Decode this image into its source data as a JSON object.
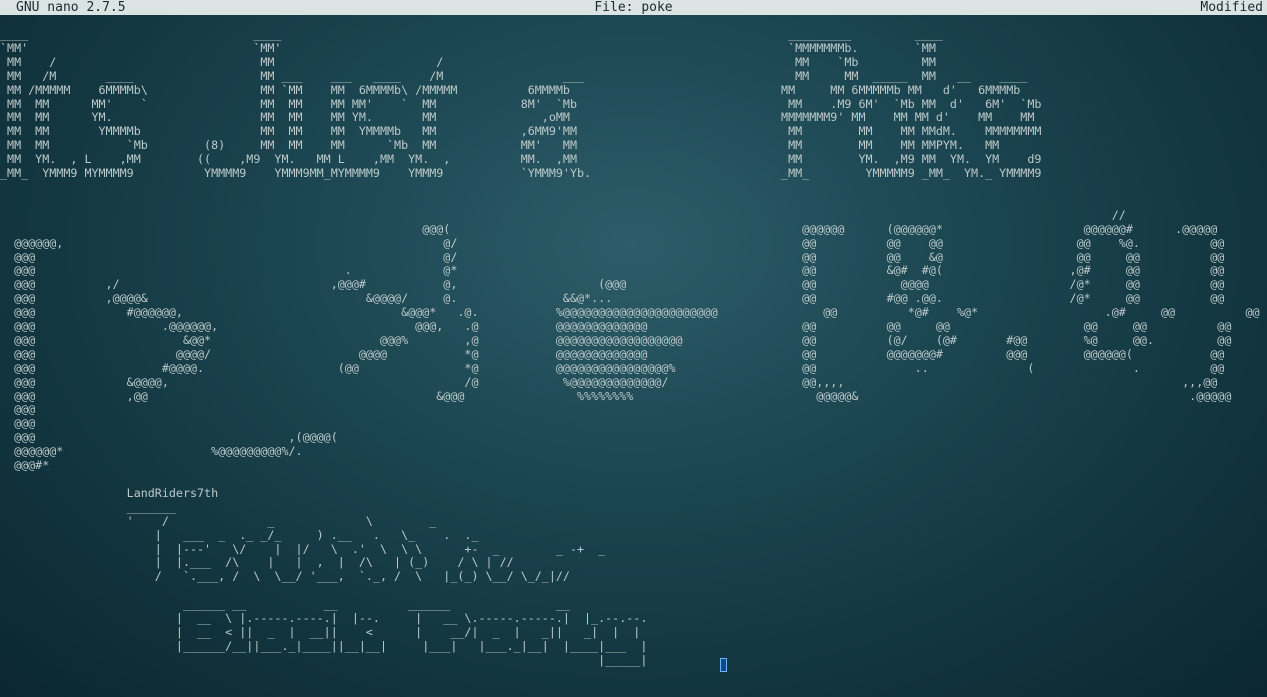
{
  "titlebar": {
    "version": "GNU nano 2.7.5",
    "file": "File: poke",
    "status": "Modified"
  },
  "buffer": {
    "lines": [
      "____                                ____                                                                        _________         ____",
      "`MM'                                `MM'                                                                        `MMMMMMMb.        `MM",
      " MM    /                             MM                       /                                                  MM    `Mb         MM",
      " MM   /M       ____                  MM ___    ___   ____    /M                 ___                              MM     MM  _____  MM   __    ____",
      " MM /MMMMM    6MMMMb\\                MM `MM    MM  6MMMMb\\ /MMMMM          6MMMMb                              MM     MM 6MMMMMb MM   d'   6MMMMb",
      " MM  MM      MM'    `                MM  MM    MM MM'    `  MM            8M'  `Mb                              MM    .M9 6M'  `Mb MM  d'   6M'  `Mb",
      " MM  MM      YM.                     MM  MM    MM YM.       MM               ,oMM                              MMMMMMM9' MM    MM MM d'    MM    MM",
      " MM  MM       YMMMMb                 MM  MM    MM  YMMMMb   MM            ,6MM9'MM                              MM        MM    MM MMdM.    MMMMMMMM",
      " MM  MM           `Mb        (8)     MM  MM    MM      `Mb  MM            MM'   MM                              MM        MM    MM MMPYM.   MM",
      " MM  YM.  , L    ,MM        ((    ,M9  YM.   MM L    ,MM  YM.  ,          MM.  ,MM                              MM        YM.  ,M9 MM  YM.  YM    d9",
      "_MM_  YMMM9 MYMMMM9          YMMMM9    YMMM9MM_MYMMMM9    YMMM9           `YMMM9'Yb.                           _MM_        YMMMMM9 _MM_  YM._ YMMMM9",
      "",
      "",
      "                                                                                                                                                              //                          */.",
      "                                                            @@@(                                                  @@@@@@      (@@@@@@*                    @@@@@@#      .@@@@@",
      "  @@@@@@,                                                      @/                                                 @@          @@    @@                   @@    %@.          @@",
      "  @@@                                                          @/                                                 @@          @@    &@                   @@     @@          @@",
      "  @@@                                            .             @*                                                 @@          &@#  #@(                  ,@#     @@          @@",
      "  @@@          ,/                              ,@@@#           @,                    (@@@                         @@            @@@@                    /@*     @@          @@",
      "  @@@          ,@@@@&                               &@@@@/     @.               &&@*...                           @@          #@@ .@@.                  /@*     @@          @@",
      "  @@@             #@@@@@@,                               &@@@*   .@.           %@@@@@@@@@@@@@@@@@@@@@@               @@          *@#    %@*                  .@#     @@          @@",
      "  @@@                  .@@@@@@,                            @@@,   .@           @@@@@@@@@@@@@                      @@          @@     @@                   @@     @@          @@",
      "  @@@                     &@@*                        @@@%        ,@           @@@@@@@@@@@@@@@@@@                 @@          (@/    (@#       #@@        %@     @@.         @@",
      "  @@@                    @@@@/                     @@@@           *@           @@@@@@@@@@@@@                      @@          @@@@@@@#         @@@        @@@@@@(           @@",
      "  @@@                  #@@@@.                   (@@               *@           @@@@@@@@@@@@@@@@%                  @@              ..              (              .          @@",
      "  @@@             &@@@@,                                          /@            %@@@@@@@@@@@@@/                   @@,,,,                                                ,,,@@",
      "  @@@             ,@@                                         &@@@                %%%%%%%%                          @@@@@&                                               .@@@@@",
      "  @@@",
      "  @@@",
      "  @@@                                    ,(@@@@(",
      "  @@@@@@*                     %@@@@@@@@@%/.",
      "  @@@#*",
      "",
      "                  LandRiders7th",
      "                  _______",
      "                  '    /              _             \\        _",
      "                      |   ___  _  ._ _/_     ) .__   .   \\_    .  ._",
      "                      |  |---'   \\/    |  |/   \\  .'  \\  \\ \\      +-  _        _ -+  _",
      "                      |  |.___  /\\    |   |  ,  |  /\\   | (_)    / \\ | //",
      "                      /   `.___, /  \\  \\__/ '___,  `._, /  \\   |_(_) \\__/ \\_/_|//",
      "",
      "                          ______ __           __          ______               __",
      "                         |  __  \\ |.-----.----.|  |--.     |   __ \\.-----.-----.|  |_.--.--.",
      "                         |  __  < ||  _  |  __||    <      |    __/|  _  |   _||   _|  |  |",
      "                         |______/__||___._|____||__|__|     |___|   |___._|__|  |____|___  |",
      "                                                                                     |_____|"
    ]
  },
  "colors": {
    "background": "#1c4753",
    "text": "#bcc9c9",
    "titlebar_bg": "#dce3e3",
    "titlebar_text": "#1a2b30",
    "cursor": "#6fb3ff"
  }
}
